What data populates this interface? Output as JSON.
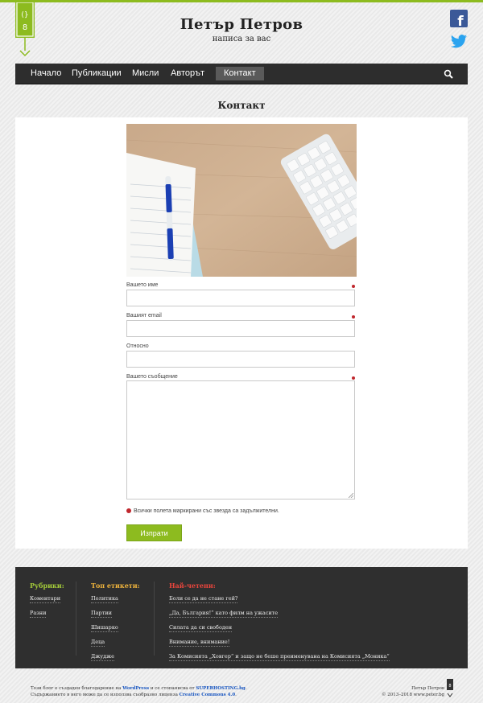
{
  "header": {
    "title": "Петър Петров",
    "subtitle": "написа за вас"
  },
  "nav": {
    "items": [
      {
        "label": "Начало"
      },
      {
        "label": "Публикации"
      },
      {
        "label": "Мисли"
      },
      {
        "label": "Авторът"
      },
      {
        "label": "Контакт",
        "active": true
      }
    ]
  },
  "page": {
    "heading": "Контакт"
  },
  "form": {
    "name_label": "Вашето име",
    "email_label": "Вашият email",
    "subject_label": "Относно",
    "message_label": "Вашето съобщение",
    "required_note": "Всички полета маркирани със звезда са задължителни.",
    "submit_label": "Изпрати"
  },
  "footer": {
    "categories": {
      "title": "Рубрики:",
      "items": [
        "Коментари",
        "Разни"
      ]
    },
    "tags": {
      "title": "Топ етикети:",
      "items": [
        "Политика",
        "Партии",
        "Шишарко",
        "Деца",
        "Джуджe"
      ]
    },
    "popular": {
      "title": "Най-четени:",
      "items": [
        "Боли се да не стане гей?",
        "„Да, България!“ като филм на ужасите",
        "Силата да си свободен",
        "Внимание, внимание!",
        "За Комисията „Ховгер“ и защо не беше преименувана на Комисията „Моника“"
      ]
    }
  },
  "bottom": {
    "line1_a": "Този блог е създаден благодарение на ",
    "wordpress": "WordPress",
    "line1_b": " и се стопанисва от ",
    "hosting": "SUPERHOSTING.bg",
    "line1_c": ".",
    "line2_a": "Съдържанието в него може да се използва съобразно лиценза ",
    "license": "Creative Commons 4.0",
    "line2_b": ".",
    "right_name": "Петър Петров",
    "right_copy": "© 2013–2018 www.peter.bg"
  },
  "colors": {
    "accent": "#8dbb1f",
    "categories_title": "#a5cc3a",
    "tags_title": "#f0b43c",
    "popular_title": "#e8453c",
    "required": "#c0272d"
  }
}
